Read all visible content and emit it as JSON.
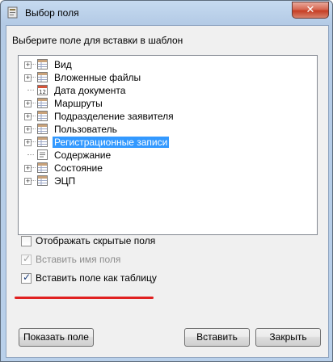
{
  "window": {
    "title": "Выбор поля",
    "close_label": "✕"
  },
  "dialog": {
    "prompt": "Выберите поле для вставки в шаблон",
    "tree": [
      {
        "label": "Вид",
        "expandable": true,
        "icon": "table-icon"
      },
      {
        "label": "Вложенные файлы",
        "expandable": true,
        "icon": "table-icon"
      },
      {
        "label": "Дата документа",
        "expandable": false,
        "icon": "calendar-icon"
      },
      {
        "label": "Маршруты",
        "expandable": true,
        "icon": "table-icon"
      },
      {
        "label": "Подразделение заявителя",
        "expandable": true,
        "icon": "table-icon"
      },
      {
        "label": "Пользователь",
        "expandable": true,
        "icon": "table-icon"
      },
      {
        "label": "Регистрационные записи",
        "expandable": true,
        "icon": "table-icon",
        "selected": true
      },
      {
        "label": "Содержание",
        "expandable": false,
        "icon": "text-field-icon"
      },
      {
        "label": "Состояние",
        "expandable": true,
        "icon": "table-icon"
      },
      {
        "label": "ЭЦП",
        "expandable": true,
        "icon": "table-icon"
      }
    ],
    "options": {
      "show_hidden": {
        "label": "Отображать скрытые поля",
        "checked": false,
        "enabled": true
      },
      "insert_name": {
        "label": "Вставить имя поля",
        "checked": true,
        "enabled": false
      },
      "insert_as_table": {
        "label": "Вставить поле как таблицу",
        "checked": true,
        "enabled": true
      }
    },
    "buttons": {
      "show_field": "Показать поле",
      "insert": "Вставить",
      "close": "Закрыть"
    }
  },
  "colors": {
    "selection": "#3399ff",
    "annotation_underline": "#e02020"
  }
}
